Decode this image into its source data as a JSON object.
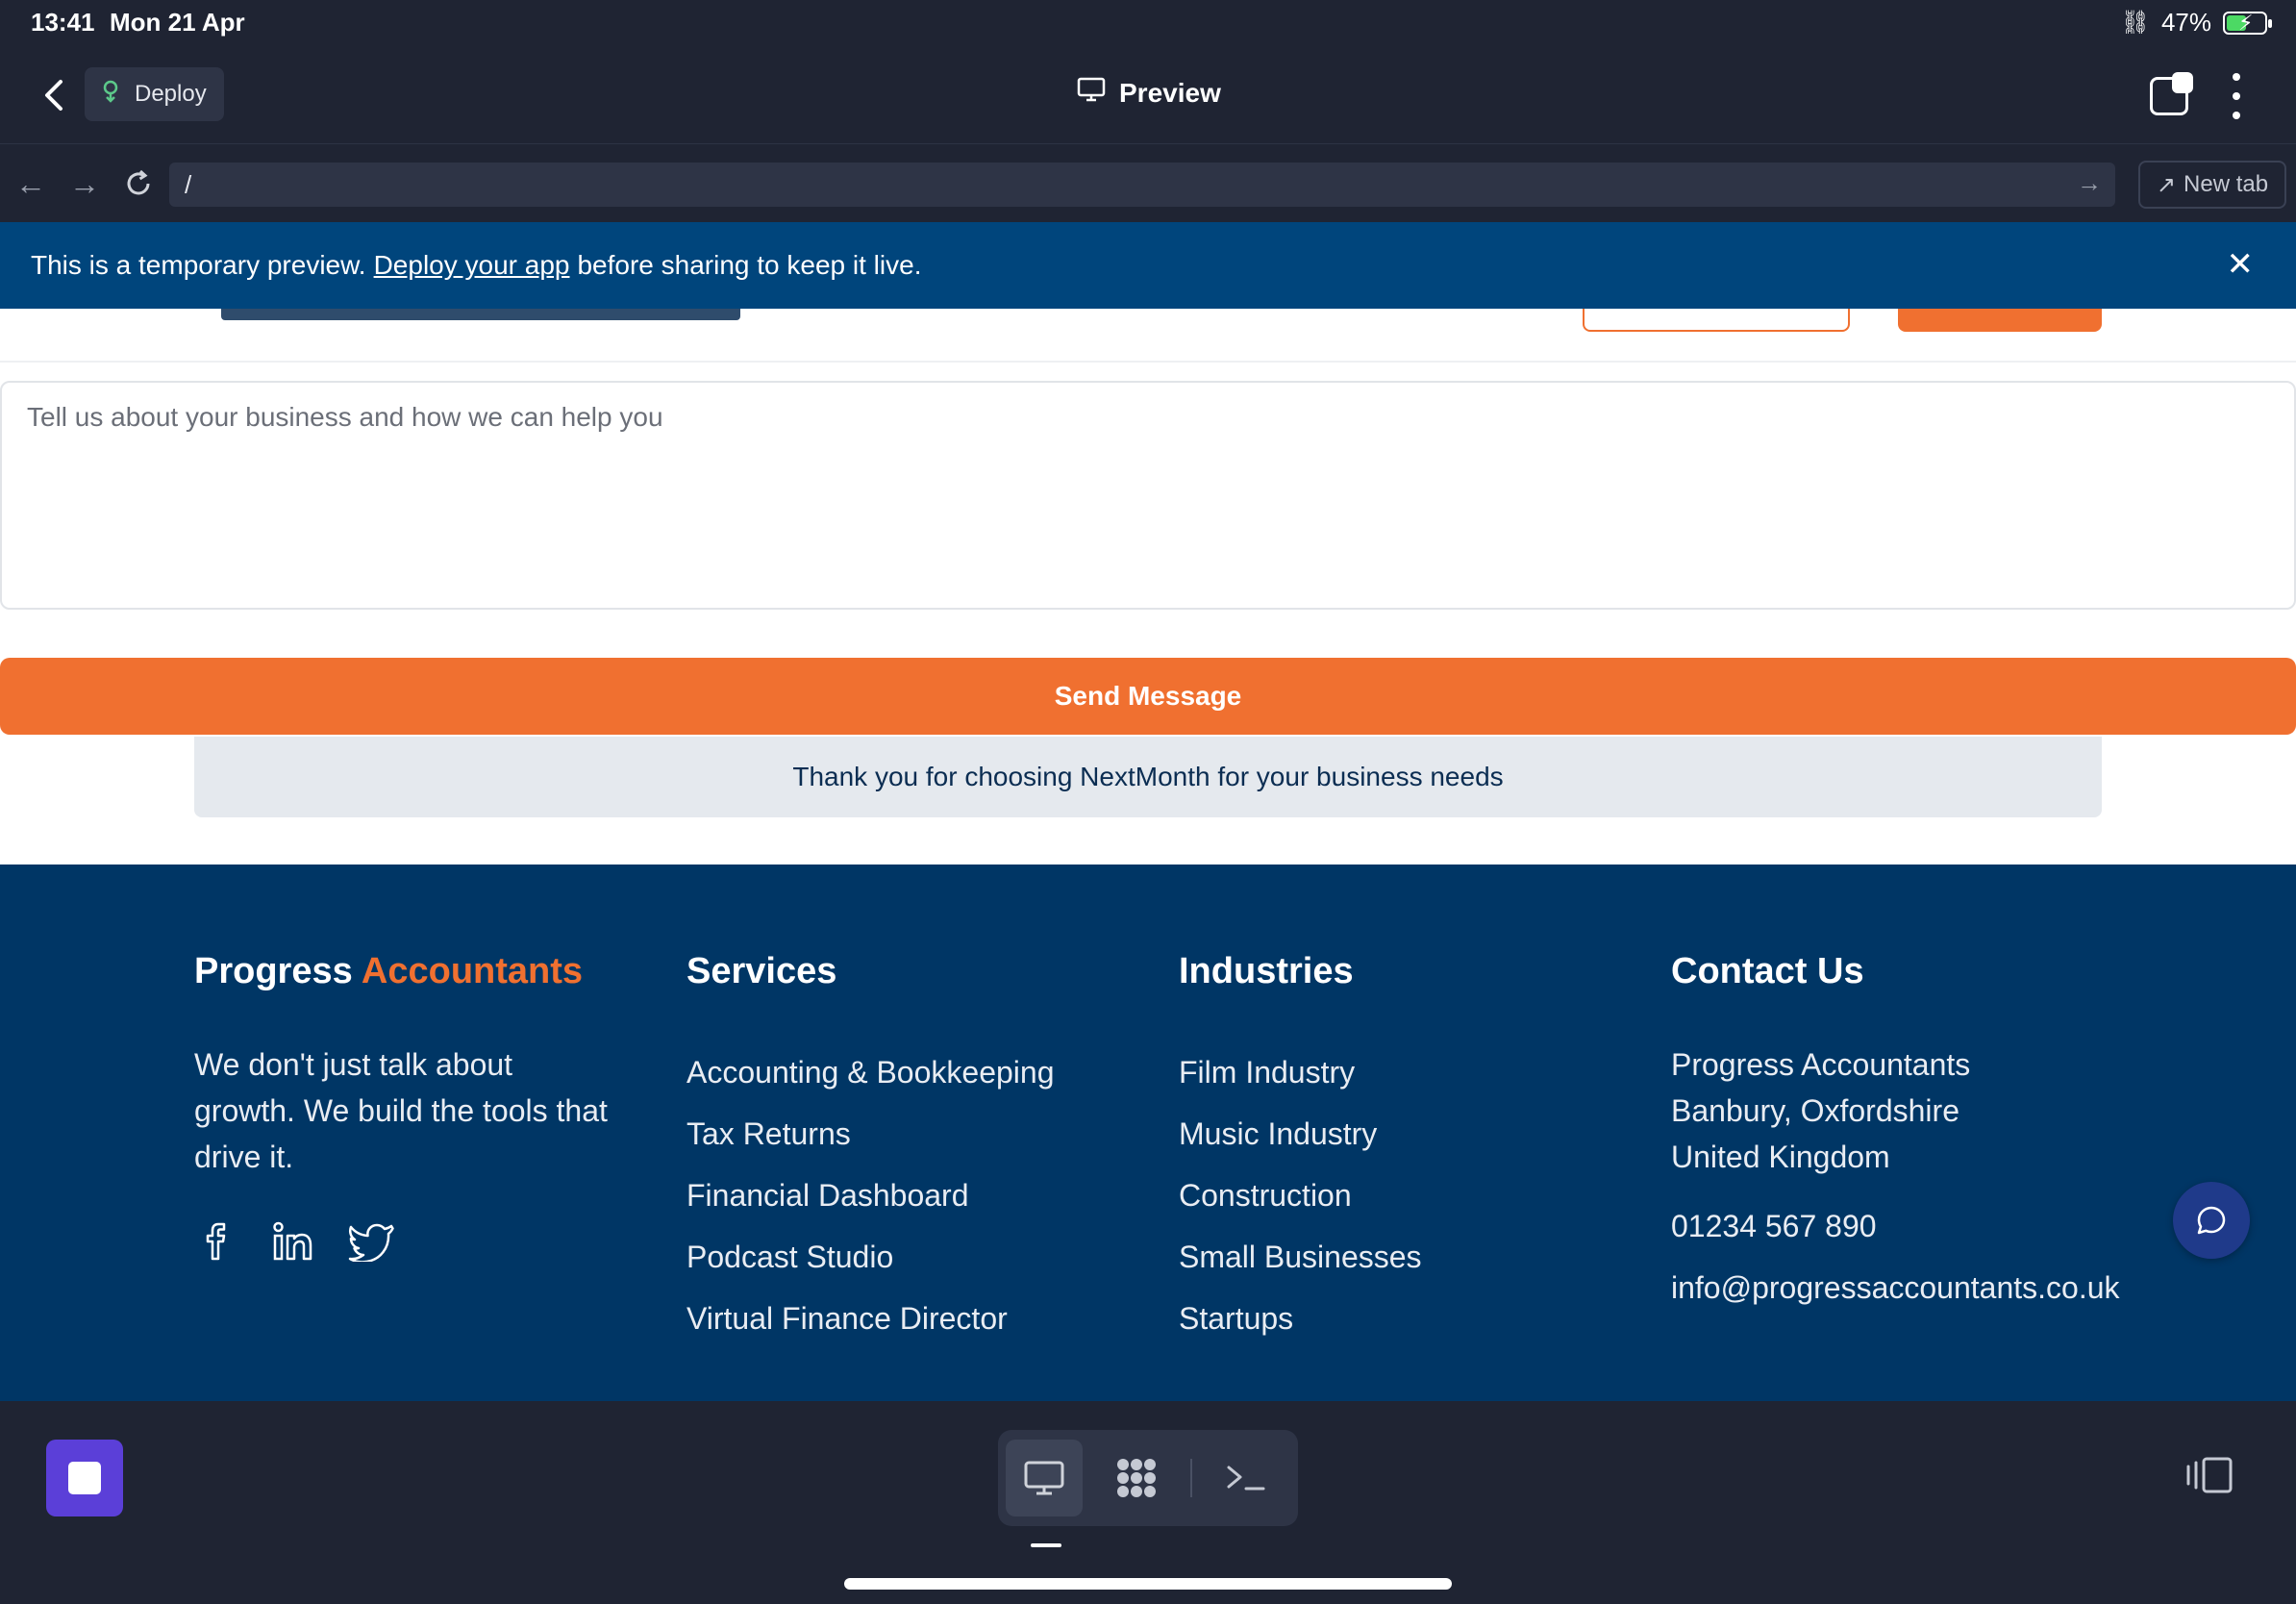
{
  "status_bar": {
    "time": "13:41",
    "date": "Mon 21 Apr",
    "battery": "47%"
  },
  "header": {
    "deploy_label": "Deploy",
    "title": "Preview"
  },
  "url_bar": {
    "url": "/",
    "new_tab_label": "New tab"
  },
  "banner": {
    "text_before": "This is a temporary preview.",
    "link": "Deploy your app",
    "text_after": "before sharing to keep it live."
  },
  "form": {
    "message_placeholder": "Tell us about your business and how we can help you",
    "send_label": "Send Message",
    "thank_you": "Thank you for choosing NextMonth for your business needs"
  },
  "footer": {
    "brand_first": "Progress",
    "brand_accent": "Accountants",
    "tagline": "We don't just talk about growth. We build the tools that drive it.",
    "services_title": "Services",
    "services": [
      "Accounting & Bookkeeping",
      "Tax Returns",
      "Financial Dashboard",
      "Podcast Studio",
      "Virtual Finance Director"
    ],
    "industries_title": "Industries",
    "industries": [
      "Film Industry",
      "Music Industry",
      "Construction",
      "Small Businesses",
      "Startups"
    ],
    "contact_title": "Contact Us",
    "address": [
      "Progress Accountants",
      "Banbury, Oxfordshire",
      "United Kingdom"
    ],
    "phone": "01234 567 890",
    "email": "info@progressaccountants.co.uk"
  },
  "colors": {
    "accent": "#f07030",
    "footer_bg": "#003665",
    "banner_bg": "#00457c",
    "chrome_bg": "#1f2433"
  }
}
